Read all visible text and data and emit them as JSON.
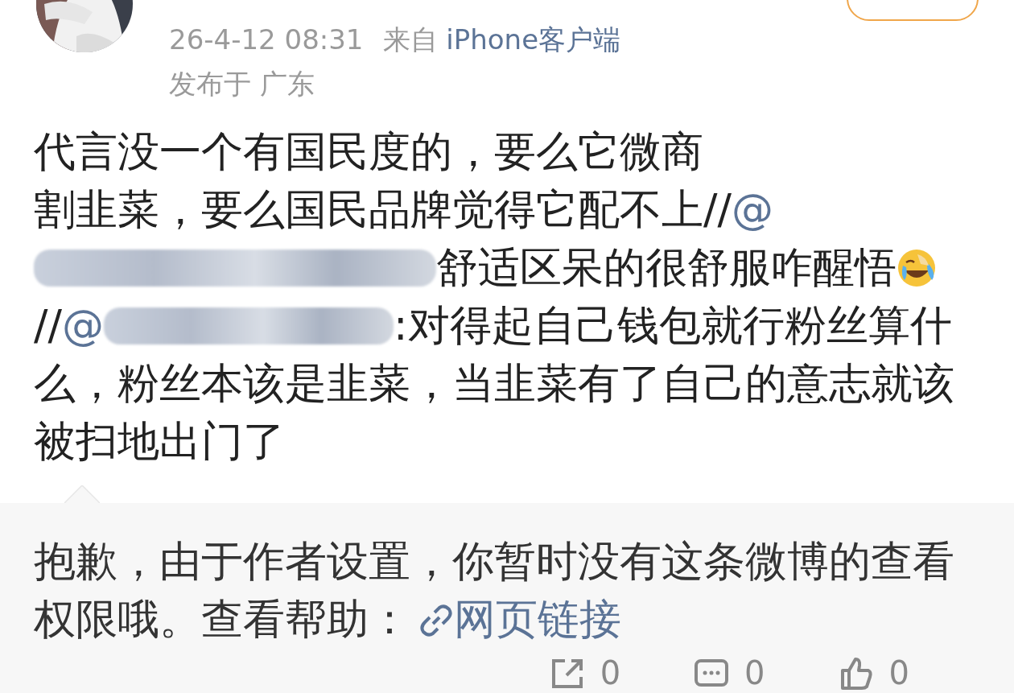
{
  "post": {
    "time": "26-4-12 08:31",
    "source_prefix": "来自",
    "source": "iPhone客户端",
    "location": "发布于 广东",
    "segments": [
      {
        "kind": "text",
        "text": "代言没一个有国民度的，要么它微商"
      },
      {
        "kind": "break"
      },
      {
        "kind": "text",
        "text": "割韭菜，要么国民品牌觉得它配不上//"
      },
      {
        "kind": "mention",
        "text": "@"
      },
      {
        "kind": "redacted"
      },
      {
        "kind": "text",
        "text": "舒适区呆的很舒服咋醒悟"
      },
      {
        "kind": "emoji"
      },
      {
        "kind": "text",
        "text": "//"
      },
      {
        "kind": "mention",
        "text": "@"
      },
      {
        "kind": "redacted"
      },
      {
        "kind": "text",
        "text": ":对得起自己钱包就行粉丝算什么，粉丝本该是韭菜，当韭菜有了自己的意志就该被扫地出门了"
      }
    ]
  },
  "notice": {
    "text": "抱歉，由于作者设置，你暂时没有这条微博的查看权限哦。查看帮助：",
    "link": "网页链接"
  },
  "actions": [
    {
      "kind": "share",
      "count": "0"
    },
    {
      "kind": "comment",
      "count": "0"
    },
    {
      "kind": "like",
      "count": "0"
    }
  ]
}
